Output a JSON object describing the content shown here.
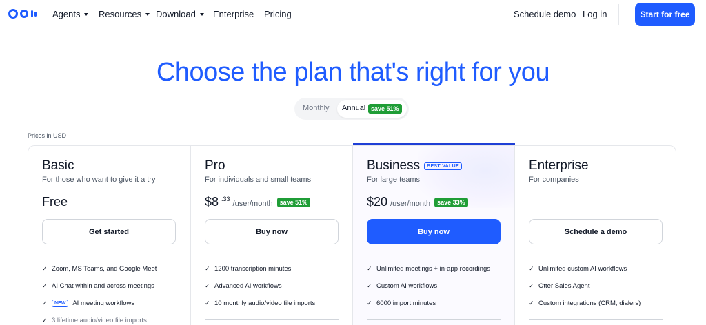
{
  "nav": {
    "items": [
      {
        "label": "Agents",
        "dropdown": true
      },
      {
        "label": "Resources",
        "dropdown": true
      },
      {
        "label": "Download",
        "dropdown": true
      },
      {
        "label": "Enterprise",
        "dropdown": false
      },
      {
        "label": "Pricing",
        "dropdown": false
      }
    ],
    "schedule_demo": "Schedule demo",
    "login": "Log in",
    "cta": "Start for free"
  },
  "headline": "Choose the plan that's right for you",
  "billing_toggle": {
    "monthly": "Monthly",
    "annual": "Annual",
    "annual_badge": "save 51%",
    "selected": "Annual"
  },
  "prices_currency_note": "Prices in USD",
  "plans": [
    {
      "name": "Basic",
      "description": "For those who want to give it a try",
      "price": "Free",
      "price_sup": "",
      "per": "",
      "badge": "",
      "button": "Get started",
      "features": [
        {
          "text": "Zoom, MS Teams, and Google Meet",
          "new": ""
        },
        {
          "text": "AI Chat within and across meetings",
          "new": ""
        },
        {
          "text": "AI meeting workflows",
          "new": "NEW"
        },
        {
          "text": "3 lifetime audio/video file imports",
          "new": ""
        }
      ]
    },
    {
      "name": "Pro",
      "description": "For individuals and small teams",
      "price": "$8",
      "price_sup": ".33",
      "per": "/user/month",
      "badge": "save 51%",
      "button": "Buy now",
      "features": [
        {
          "text": "1200 transcription minutes",
          "new": ""
        },
        {
          "text": "Advanced AI workflows",
          "new": ""
        },
        {
          "text": "10 monthly audio/video file imports",
          "new": ""
        }
      ]
    },
    {
      "name": "Business",
      "tag": "BEST VALUE",
      "description": "For large teams",
      "price": "$20",
      "price_sup": "",
      "per": "/user/month",
      "badge": "save 33%",
      "button": "Buy now",
      "features": [
        {
          "text": "Unlimited meetings + in-app recordings",
          "new": ""
        },
        {
          "text": "Custom AI workflows",
          "new": ""
        },
        {
          "text": "6000 import minutes",
          "new": ""
        }
      ]
    },
    {
      "name": "Enterprise",
      "description": "For companies",
      "price": "",
      "button": "Schedule a demo",
      "features": [
        {
          "text": "Unlimited custom AI workflows",
          "new": ""
        },
        {
          "text": "Otter Sales Agent",
          "new": ""
        },
        {
          "text": "Custom integrations (CRM, dialers)",
          "new": ""
        }
      ]
    }
  ],
  "colors": {
    "brand": "#1f5cff",
    "save_badge": "#1f9d36"
  }
}
